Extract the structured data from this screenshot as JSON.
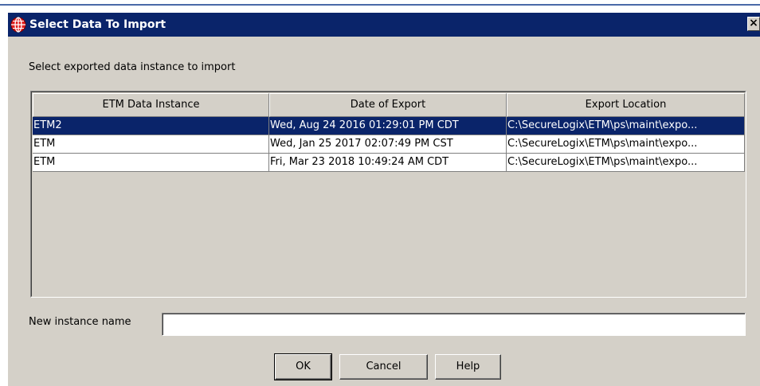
{
  "window": {
    "title": "Select Data To Import",
    "close_glyph": "×",
    "icon": "globe-icon",
    "title_bar_color": "#0a246a",
    "background_color": "#d4d0c8"
  },
  "prompt": "Select exported data instance to import",
  "table": {
    "headers": [
      "ETM Data Instance",
      "Date of Export",
      "Export Location"
    ],
    "rows": [
      [
        "ETM2",
        "Wed, Aug 24 2016 01:29:01 PM CDT",
        "C:\\SecureLogix\\ETM\\ps\\maint\\expo..."
      ],
      [
        "ETM",
        "Wed, Jan 25 2017 02:07:49 PM CST",
        "C:\\SecureLogix\\ETM\\ps\\maint\\expo..."
      ],
      [
        "ETM",
        "Fri, Mar 23 2018 10:49:24 AM CDT",
        "C:\\SecureLogix\\ETM\\ps\\maint\\expo..."
      ]
    ],
    "selected_row": 0,
    "selection_color": "#0a246a"
  },
  "instance_name": {
    "label": "New instance name",
    "value": ""
  },
  "buttons": {
    "ok": "OK",
    "cancel": "Cancel",
    "help": "Help"
  }
}
